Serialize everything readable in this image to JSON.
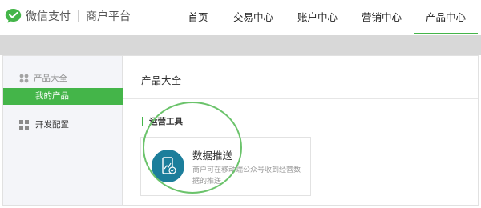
{
  "brand": {
    "name": "微信支付",
    "subtitle": "商户平台",
    "icon": "wechat-pay-logo-icon",
    "color": "#44b549"
  },
  "nav": {
    "items": [
      {
        "label": "首页"
      },
      {
        "label": "交易中心"
      },
      {
        "label": "账户中心"
      },
      {
        "label": "营销中心"
      },
      {
        "label": "产品中心",
        "active": true
      }
    ]
  },
  "sidebar": {
    "group_label": "产品大全",
    "group_icon": "grid-icon",
    "active_item": "我的产品",
    "dev_label": "开发配置",
    "dev_icon": "settings-grid-icon"
  },
  "main": {
    "title": "产品大全",
    "section_title": "运营工具",
    "card": {
      "title": "数据推送",
      "description": "商户可在移动端公众号收到经营数据的推送",
      "icon": "data-push-phone-icon"
    }
  },
  "colors": {
    "accent": "#44b549",
    "card_icon_bg": "#1c7e9b",
    "sidebar_bg": "#f4f5f9",
    "band": "#d8d8d8"
  }
}
